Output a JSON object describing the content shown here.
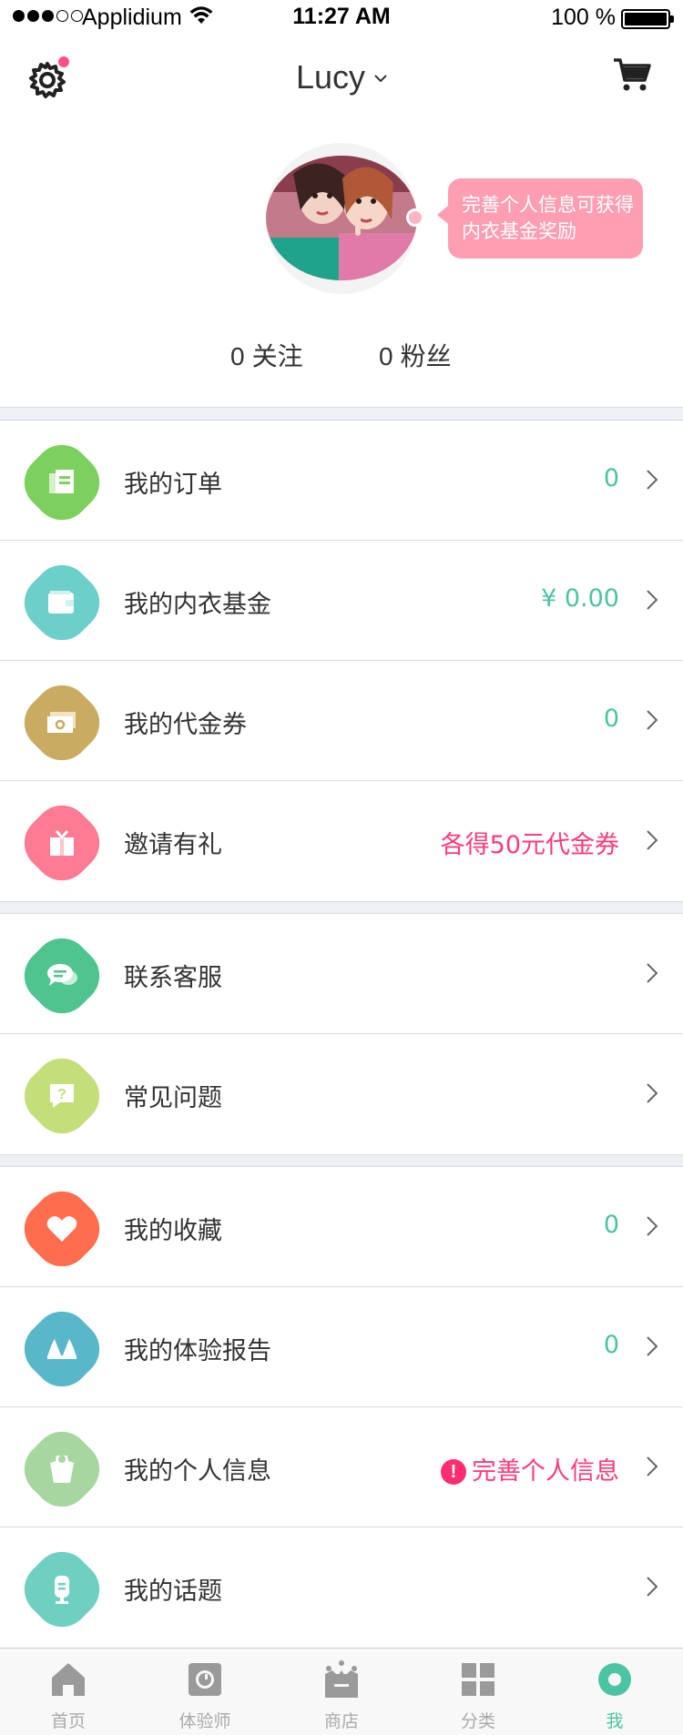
{
  "status_bar": {
    "carrier": "Applidium",
    "time": "11:27 AM",
    "battery": "100 %"
  },
  "header": {
    "user_name": "Lucy",
    "settings_icon": "gear-icon",
    "cart_icon": "cart-icon"
  },
  "profile": {
    "tip_text": "完善个人信息可获得内衣基金奖励",
    "following": {
      "count": "0",
      "label": "关注"
    },
    "followers": {
      "count": "0",
      "label": "粉丝"
    }
  },
  "menu": {
    "orders": {
      "label": "我的订单",
      "value": "0",
      "icon": "order-icon",
      "color": "#7cd05d"
    },
    "fund": {
      "label": "我的内衣基金",
      "value": "¥ 0.00",
      "icon": "wallet-icon",
      "color": "#6ccfc9"
    },
    "coupons": {
      "label": "我的代金券",
      "value": "0",
      "icon": "coupon-icon",
      "color": "#c9ac62"
    },
    "invite": {
      "label": "邀请有礼",
      "value": "各得50元代金券",
      "icon": "gift-icon",
      "color": "#ff7a93"
    },
    "service": {
      "label": "联系客服",
      "icon": "chat-icon",
      "color": "#4fc48f"
    },
    "faq": {
      "label": "常见问题",
      "icon": "question-icon",
      "color": "#c4de7a"
    },
    "favorites": {
      "label": "我的收藏",
      "value": "0",
      "icon": "heart-icon",
      "color": "#ff6d4f"
    },
    "reports": {
      "label": "我的体验报告",
      "value": "0",
      "icon": "bra-icon",
      "color": "#58b8c9"
    },
    "info": {
      "label": "我的个人信息",
      "value": "完善个人信息",
      "icon": "profile-icon",
      "color": "#a7d6a0"
    },
    "topics": {
      "label": "我的话题",
      "icon": "microphone-icon",
      "color": "#6fd0c2"
    }
  },
  "tabbar": {
    "tabs": [
      {
        "label": "首页",
        "icon": "home-icon"
      },
      {
        "label": "体验师",
        "icon": "camera-icon"
      },
      {
        "label": "商店",
        "icon": "shop-icon"
      },
      {
        "label": "分类",
        "icon": "grid-icon"
      },
      {
        "label": "我",
        "icon": "me-icon"
      }
    ],
    "active_index": 4,
    "active_color": "#4cc3a3"
  }
}
